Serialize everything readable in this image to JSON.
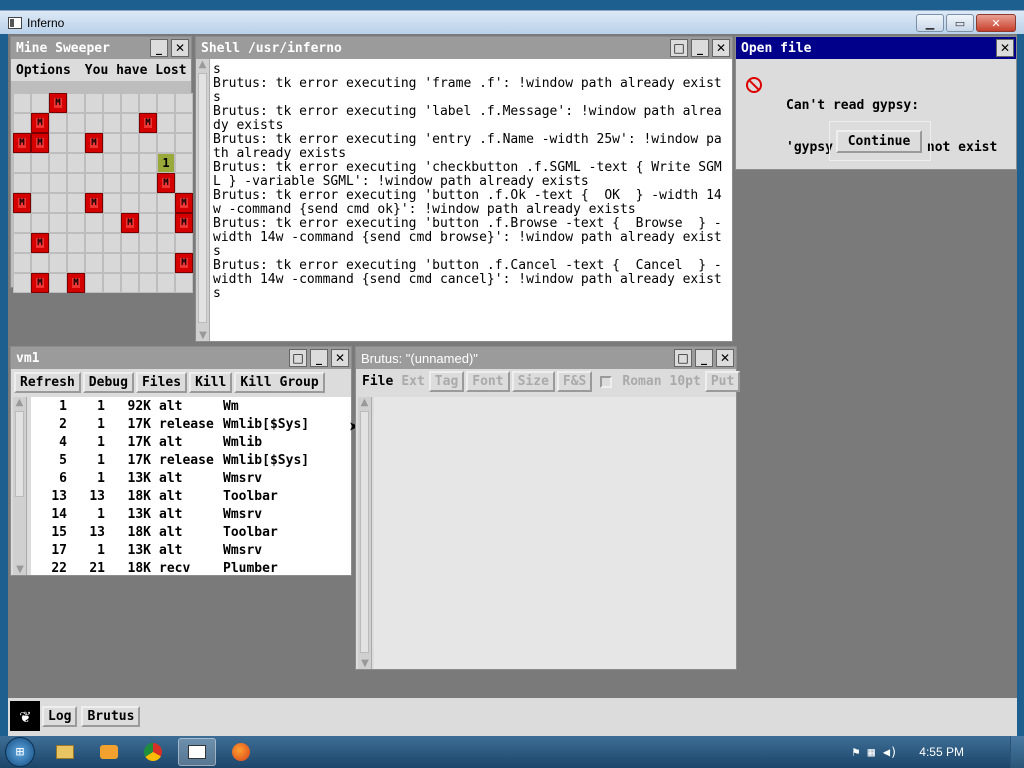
{
  "os_window": {
    "title": "Inferno",
    "min_icon": "minimize-icon",
    "max_icon": "maximize-icon",
    "close_icon": "close-icon"
  },
  "minesweeper": {
    "title": "Mine Sweeper",
    "menu_options": "Options",
    "status": "You have Lost",
    "mine_label": "M",
    "rows": [
      "..M.......",
      ".M.....M..",
      "MM..M.....",
      "........1.",
      "........M.",
      "M...M....M",
      "......M..M",
      ".M........",
      ".........M",
      ".M.M......"
    ]
  },
  "shell": {
    "title": "Shell /usr/inferno",
    "lines": [
      "s",
      "Brutus: tk error executing 'frame .f': !window path already exist",
      "s",
      "Brutus: tk error executing 'label .f.Message': !window path alrea",
      "dy exists",
      "Brutus: tk error executing 'entry .f.Name -width 25w': !window pa",
      "th already exists",
      "Brutus: tk error executing 'checkbutton .f.SGML -text { Write SGM",
      "L } -variable SGML': !window path already exists",
      "Brutus: tk error executing 'button .f.Ok -text {  OK  } -width 14",
      "w -command {send cmd ok}': !window path already exists",
      "Brutus: tk error executing 'button .f.Browse -text {  Browse  } -",
      "width 14w -command {send cmd browse}': !window path already exist",
      "s",
      "Brutus: tk error executing 'button .f.Cancel -text {  Cancel  } -",
      "width 14w -command {send cmd cancel}': !window path already exist",
      "s"
    ]
  },
  "dialog": {
    "title": "Open file",
    "message_line1": "Can't read gypsy:",
    "message_line2": "'gypsy' file does not exist",
    "button": "Continue",
    "icon": "no-entry-icon"
  },
  "vm": {
    "title": "vm1",
    "buttons": [
      "Refresh",
      "Debug",
      "Files",
      "Kill",
      "Kill Group"
    ],
    "rows": [
      [
        "1",
        "1",
        "92K",
        "alt",
        "Wm"
      ],
      [
        "2",
        "1",
        "17K",
        "release",
        "Wmlib[$Sys]"
      ],
      [
        "4",
        "1",
        "17K",
        "alt",
        "Wmlib"
      ],
      [
        "5",
        "1",
        "17K",
        "release",
        "Wmlib[$Sys]"
      ],
      [
        "6",
        "1",
        "13K",
        "alt",
        "Wmsrv"
      ],
      [
        "13",
        "13",
        "18K",
        "alt",
        "Toolbar"
      ],
      [
        "14",
        "1",
        "13K",
        "alt",
        "Wmsrv"
      ],
      [
        "15",
        "13",
        "18K",
        "alt",
        "Toolbar"
      ],
      [
        "17",
        "1",
        "13K",
        "alt",
        "Wmsrv"
      ],
      [
        "22",
        "21",
        "18K",
        "recv",
        "Plumber"
      ]
    ]
  },
  "brutus": {
    "title": "Brutus: \"(unnamed)\"",
    "menu": [
      "File",
      "Ext",
      "Tag",
      "Font",
      "Size",
      "F&S",
      "Roman",
      "10pt",
      "Put"
    ]
  },
  "inferno_taskbar": {
    "items": [
      "Log",
      "Brutus"
    ],
    "logo": "inferno-logo-icon"
  },
  "win_taskbar": {
    "time": "4:55 PM"
  }
}
